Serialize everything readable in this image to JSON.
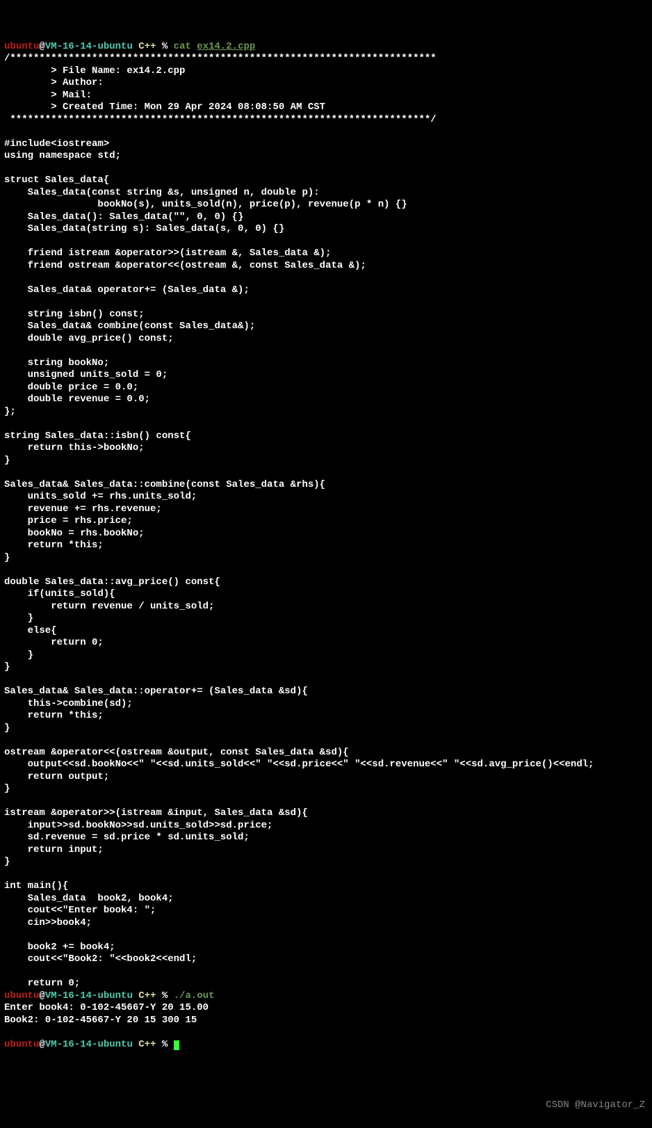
{
  "prompt1": {
    "user": "ubuntu",
    "at": "@",
    "host": "VM-16-14-ubuntu",
    "cpp": " C++ ",
    "pct": "%",
    "cat": " cat ",
    "file": "ex14.2.cpp"
  },
  "header": {
    "top": "/*************************************************************************",
    "l1": "        > File Name: ex14.2.cpp",
    "l2": "        > Author:",
    "l3": "        > Mail:",
    "l4": "        > Created Time: Mon 29 Apr 2024 08:08:50 AM CST",
    "bot": " ************************************************************************/"
  },
  "code": [
    "",
    "#include<iostream>",
    "using namespace std;",
    "",
    "struct Sales_data{",
    "    Sales_data(const string &s, unsigned n, double p):",
    "                bookNo(s), units_sold(n), price(p), revenue(p * n) {}",
    "    Sales_data(): Sales_data(\"\", 0, 0) {}",
    "    Sales_data(string s): Sales_data(s, 0, 0) {}",
    "",
    "    friend istream &operator>>(istream &, Sales_data &);",
    "    friend ostream &operator<<(ostream &, const Sales_data &);",
    "",
    "    Sales_data& operator+= (Sales_data &);",
    "",
    "    string isbn() const;",
    "    Sales_data& combine(const Sales_data&);",
    "    double avg_price() const;",
    "",
    "    string bookNo;",
    "    unsigned units_sold = 0;",
    "    double price = 0.0;",
    "    double revenue = 0.0;",
    "};",
    "",
    "string Sales_data::isbn() const{",
    "    return this->bookNo;",
    "}",
    "",
    "Sales_data& Sales_data::combine(const Sales_data &rhs){",
    "    units_sold += rhs.units_sold;",
    "    revenue += rhs.revenue;",
    "    price = rhs.price;",
    "    bookNo = rhs.bookNo;",
    "    return *this;",
    "}",
    "",
    "double Sales_data::avg_price() const{",
    "    if(units_sold){",
    "        return revenue / units_sold;",
    "    }",
    "    else{",
    "        return 0;",
    "    }",
    "}",
    "",
    "Sales_data& Sales_data::operator+= (Sales_data &sd){",
    "    this->combine(sd);",
    "    return *this;",
    "}",
    "",
    "ostream &operator<<(ostream &output, const Sales_data &sd){",
    "    output<<sd.bookNo<<\" \"<<sd.units_sold<<\" \"<<sd.price<<\" \"<<sd.revenue<<\" \"<<sd.avg_price()<<endl;",
    "    return output;",
    "}",
    "",
    "istream &operator>>(istream &input, Sales_data &sd){",
    "    input>>sd.bookNo>>sd.units_sold>>sd.price;",
    "    sd.revenue = sd.price * sd.units_sold;",
    "    return input;",
    "}",
    "",
    "int main(){",
    "    Sales_data  book2, book4;",
    "    cout<<\"Enter book4: \";",
    "    cin>>book4;",
    "",
    "    book2 += book4;",
    "    cout<<\"Book2: \"<<book2<<endl;",
    "",
    "    return 0;",
    "}"
  ],
  "prompt2": {
    "user": "ubuntu",
    "at": "@",
    "host": "VM-16-14-ubuntu",
    "cpp": " C++ ",
    "pct": "%",
    "run": " ./a.out"
  },
  "out1": "Enter book4: 0-102-45667-Y 20 15.00",
  "out2": "Book2: 0-102-45667-Y 20 15 300 15",
  "blank": "",
  "prompt3": {
    "user": "ubuntu",
    "at": "@",
    "host": "VM-16-14-ubuntu",
    "cpp": " C++ ",
    "pct": "% "
  },
  "watermark": "CSDN @Navigator_Z"
}
